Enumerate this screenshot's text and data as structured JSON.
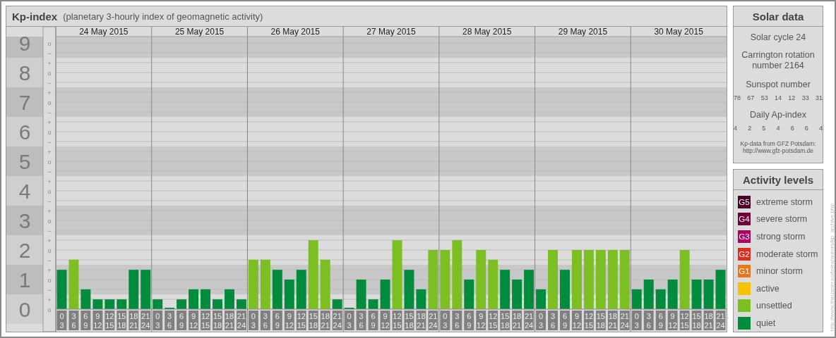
{
  "title": {
    "name": "Kp-index",
    "subtitle": "(planetary 3-hourly index of geomagnetic activity)"
  },
  "kp_scale": [
    {
      "marks": [
        "o",
        "−"
      ]
    },
    {
      "marks": [
        "+",
        "o",
        "−"
      ]
    },
    {
      "marks": [
        "+",
        "o",
        "−"
      ]
    },
    {
      "marks": [
        "+",
        "o",
        "−"
      ]
    },
    {
      "marks": [
        "+",
        "o",
        "−"
      ]
    },
    {
      "marks": [
        "+",
        "o",
        "−"
      ]
    },
    {
      "marks": [
        "+",
        "o",
        "−"
      ]
    },
    {
      "marks": [
        "+",
        "o",
        "−"
      ]
    },
    {
      "marks": [
        "+",
        "o",
        "−"
      ]
    },
    {
      "marks": [
        "+",
        "o"
      ]
    }
  ],
  "days": [
    {
      "date": "24 May 2015",
      "hours": [
        [
          "0",
          "3"
        ],
        [
          "3",
          "6"
        ],
        [
          "6",
          "9"
        ],
        [
          "9",
          "12"
        ],
        [
          "12",
          "15"
        ],
        [
          "15",
          "18"
        ],
        [
          "18",
          "21"
        ],
        [
          "21",
          "24"
        ]
      ]
    },
    {
      "date": "25 May 2015",
      "hours": [
        [
          "0",
          "3"
        ],
        [
          "3",
          "6"
        ],
        [
          "6",
          "9"
        ],
        [
          "9",
          "12"
        ],
        [
          "12",
          "15"
        ],
        [
          "15",
          "18"
        ],
        [
          "18",
          "21"
        ],
        [
          "21",
          "24"
        ]
      ]
    },
    {
      "date": "26 May 2015",
      "hours": [
        [
          "0",
          "3"
        ],
        [
          "3",
          "6"
        ],
        [
          "6",
          "9"
        ],
        [
          "9",
          "12"
        ],
        [
          "12",
          "15"
        ],
        [
          "15",
          "18"
        ],
        [
          "18",
          "21"
        ],
        [
          "21",
          "24"
        ]
      ]
    },
    {
      "date": "27 May 2015",
      "hours": [
        [
          "0",
          "3"
        ],
        [
          "3",
          "6"
        ],
        [
          "6",
          "9"
        ],
        [
          "9",
          "12"
        ],
        [
          "12",
          "15"
        ],
        [
          "15",
          "18"
        ],
        [
          "18",
          "21"
        ],
        [
          "21",
          "24"
        ]
      ]
    },
    {
      "date": "28 May 2015",
      "hours": [
        [
          "0",
          "3"
        ],
        [
          "3",
          "6"
        ],
        [
          "6",
          "9"
        ],
        [
          "9",
          "12"
        ],
        [
          "12",
          "15"
        ],
        [
          "15",
          "18"
        ],
        [
          "18",
          "21"
        ],
        [
          "21",
          "24"
        ]
      ]
    },
    {
      "date": "29 May 2015",
      "hours": [
        [
          "0",
          "3"
        ],
        [
          "3",
          "6"
        ],
        [
          "6",
          "9"
        ],
        [
          "9",
          "12"
        ],
        [
          "12",
          "15"
        ],
        [
          "15",
          "18"
        ],
        [
          "18",
          "21"
        ],
        [
          "21",
          "24"
        ]
      ]
    },
    {
      "date": "30 May 2015",
      "hours": [
        [
          "0",
          "3"
        ],
        [
          "3",
          "6"
        ],
        [
          "6",
          "9"
        ],
        [
          "9",
          "12"
        ],
        [
          "12",
          "15"
        ],
        [
          "15",
          "18"
        ],
        [
          "18",
          "21"
        ],
        [
          "21",
          "24"
        ]
      ]
    }
  ],
  "chart_data": {
    "type": "bar",
    "grid": true,
    "ylim": [
      0,
      9
    ],
    "bands": [
      {
        "axis": "y",
        "from": 8.5,
        "to": 9.2
      },
      {
        "axis": "y",
        "from": 6.5,
        "to": 7.5
      },
      {
        "axis": "y",
        "from": 4.5,
        "to": 5.5
      },
      {
        "axis": "y",
        "from": 2.5,
        "to": 3.5
      },
      {
        "axis": "y",
        "from": 0.5,
        "to": 1.5
      }
    ],
    "yticks": [
      0,
      1,
      2,
      3,
      4,
      5,
      6,
      7,
      8,
      9
    ],
    "categories": [
      null,
      null,
      null,
      null,
      null,
      null,
      null,
      null,
      null,
      null,
      null,
      null,
      null,
      null,
      null,
      null,
      null,
      null,
      null,
      null,
      null,
      null,
      null,
      null,
      null,
      null,
      null,
      null,
      null,
      null,
      null,
      null,
      null,
      null,
      null,
      null,
      null,
      null,
      null,
      null,
      null,
      null,
      null,
      null,
      null,
      null,
      null,
      null,
      null,
      null,
      null,
      null,
      null,
      null,
      null,
      null
    ],
    "series": [
      {
        "values": [
          1.33,
          1.67,
          0.67,
          0.33,
          0.33,
          0.33,
          1.33,
          1.33,
          0.33,
          0,
          0.33,
          0.67,
          0.67,
          0.33,
          0.67,
          0.33,
          1.67,
          1.67,
          1.33,
          1,
          1.33,
          2.33,
          1.67,
          0.33,
          0,
          1,
          0.33,
          1,
          2.33,
          1.33,
          0.67,
          2,
          2,
          2.33,
          1,
          2,
          1.67,
          1.33,
          1,
          1.33,
          0.67,
          2,
          1.33,
          2,
          2,
          2,
          2,
          2,
          0.67,
          1,
          0.67,
          1,
          2,
          1,
          1,
          1.33
        ]
      }
    ]
  },
  "solar_data": {
    "title": "Solar data",
    "cycle": "Solar cycle 24",
    "carrington": "Carrington rotation number 2164",
    "sunspot_heading": "Sunspot number",
    "sunspots": [
      "78",
      "67",
      "53",
      "14",
      "12",
      "33",
      "31"
    ],
    "ap_heading": "Daily Ap-index",
    "ap_values": [
      "4",
      "2",
      "5",
      "4",
      "6",
      "6",
      "4"
    ],
    "source": "Kp-data from GFZ Potsdam:",
    "source_url": "http://www.gfz-potsdam.de"
  },
  "activity_levels": {
    "title": "Activity levels",
    "items": [
      {
        "badge": "G5",
        "label": "extreme storm",
        "color": "#4a0025"
      },
      {
        "badge": "G4",
        "label": "severe storm",
        "color": "#6e0038"
      },
      {
        "badge": "G3",
        "label": "strong storm",
        "color": "#ad0060"
      },
      {
        "badge": "G2",
        "label": "moderate storm",
        "color": "#dc2e1c"
      },
      {
        "badge": "G1",
        "label": "minor storm",
        "color": "#e8761c"
      },
      {
        "label": "active",
        "color": "#f7c200"
      },
      {
        "label": "unsettled",
        "color": "#7bbf22"
      },
      {
        "label": "quiet",
        "color": "#008c3c"
      }
    ]
  },
  "credit": "http://www.theusner.eu/terra/aurora/kp_archive.php"
}
